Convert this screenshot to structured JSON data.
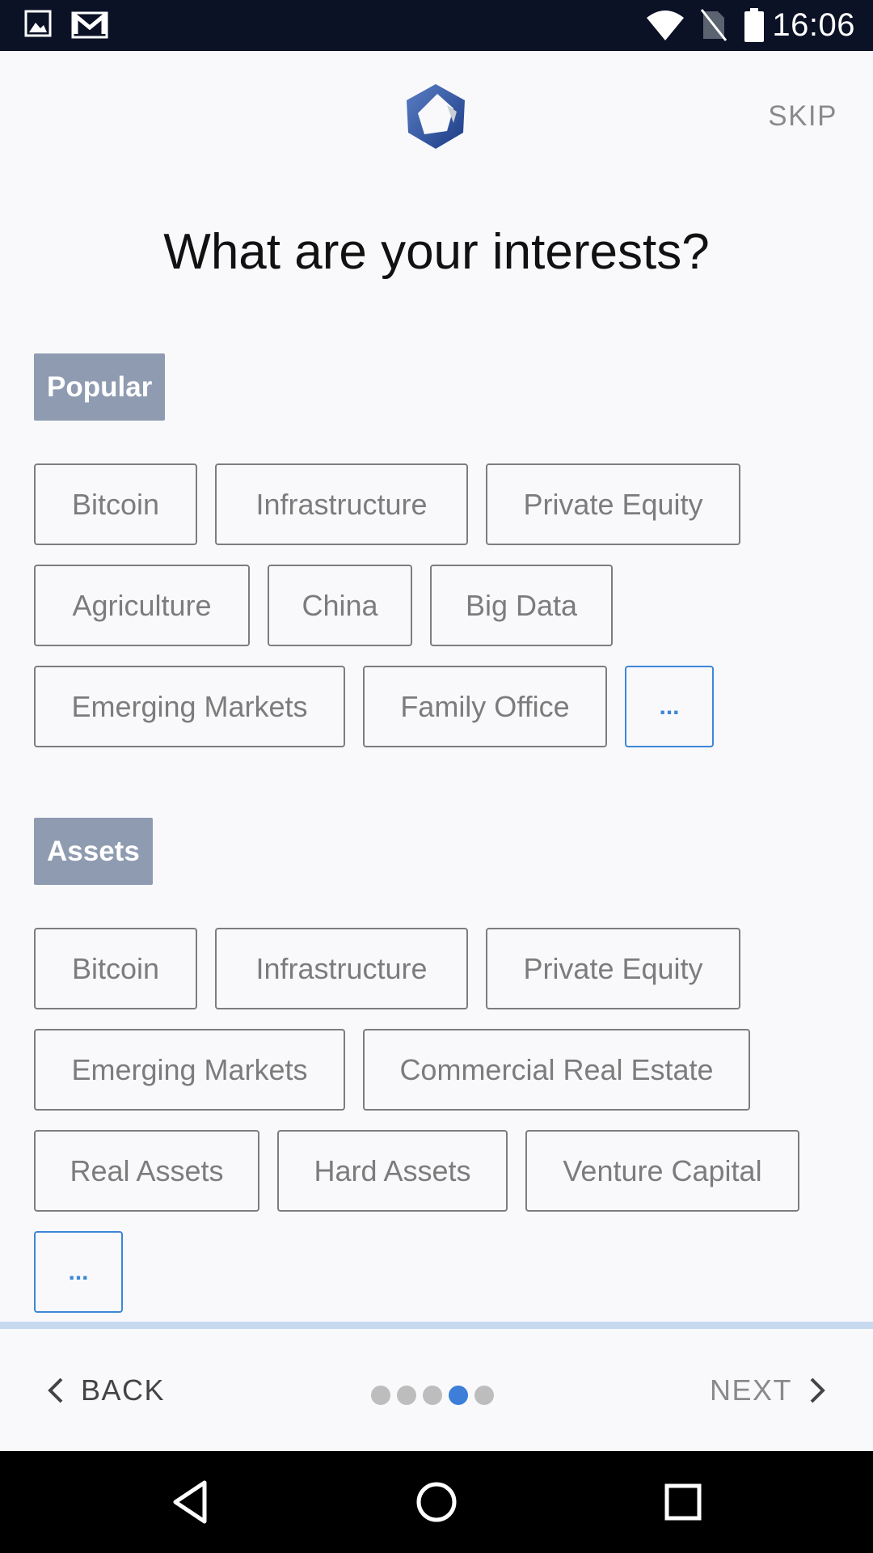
{
  "status_bar": {
    "time": "16:06",
    "icons": [
      "image-notification-icon",
      "gmail-notification-icon",
      "wifi-icon",
      "no-sim-icon",
      "battery-icon"
    ]
  },
  "header": {
    "skip_label": "SKIP",
    "logo": "app-logo-icon"
  },
  "title": "What are your interests?",
  "sections": [
    {
      "label": "Popular",
      "chips": [
        "Bitcoin",
        "Infrastructure",
        "Private Equity",
        "Agriculture",
        "China",
        "Big Data",
        "Emerging Markets",
        "Family Office"
      ],
      "more_label": "..."
    },
    {
      "label": "Assets",
      "chips": [
        "Bitcoin",
        "Infrastructure",
        "Private Equity",
        "Emerging Markets",
        "Commercial Real Estate",
        "Real Assets",
        "Hard Assets",
        "Venture Capital"
      ],
      "more_label": "..."
    }
  ],
  "bottom_nav": {
    "back_label": "BACK",
    "next_label": "NEXT",
    "page_count": 5,
    "current_page": 4
  },
  "colors": {
    "accent": "#3d86d6",
    "section_label_bg": "#8e9bb0",
    "chip_border": "#7d7d7d",
    "divider": "#c6d9ef",
    "status_bar_bg": "#0b1226"
  }
}
